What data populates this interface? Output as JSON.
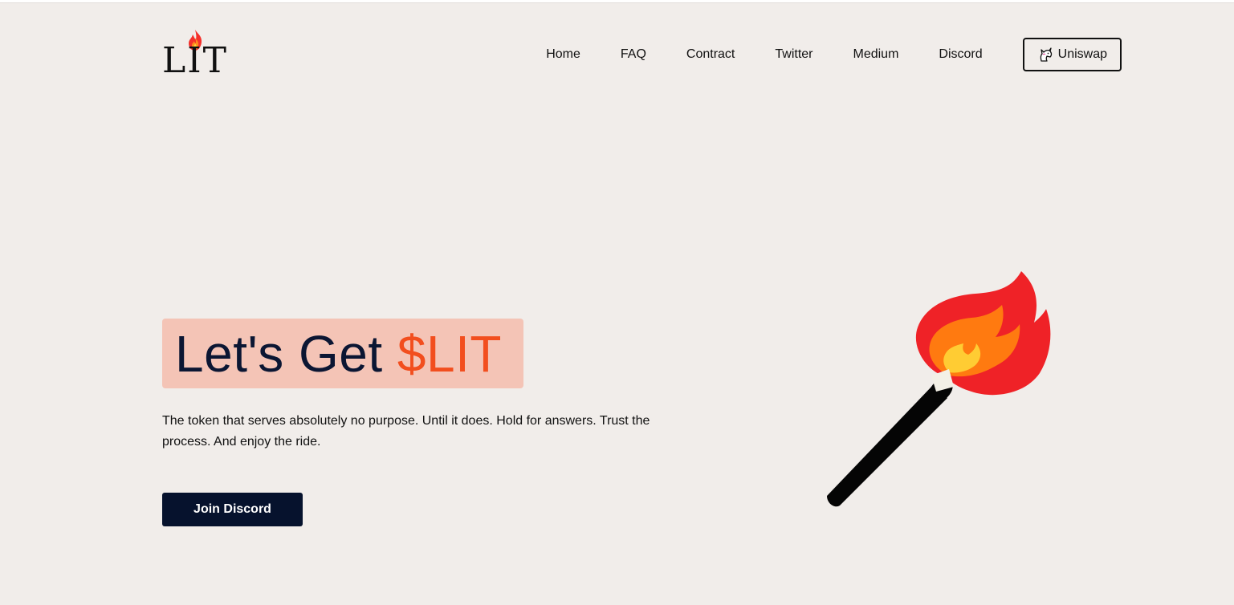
{
  "brand": {
    "logo_text": "LIT"
  },
  "nav": {
    "links": [
      "Home",
      "FAQ",
      "Contract",
      "Twitter",
      "Medium",
      "Discord"
    ],
    "uniswap_label": "Uniswap"
  },
  "hero": {
    "title_prefix": "Let's Get ",
    "title_accent": "$LIT",
    "description": "The token that serves absolutely no purpose. Until it does. Hold for answers. Trust the process. And enjoy the ride.",
    "cta_label": "Join Discord"
  },
  "colors": {
    "background": "#f1edea",
    "text": "#0b1633",
    "accent": "#f24e1e",
    "title_highlight": "#f4c4b6",
    "button": "#06122d"
  },
  "icons": {
    "logo_flame": "flame-icon",
    "uniswap": "unicorn-icon",
    "hero_image": "torch-illustration"
  }
}
